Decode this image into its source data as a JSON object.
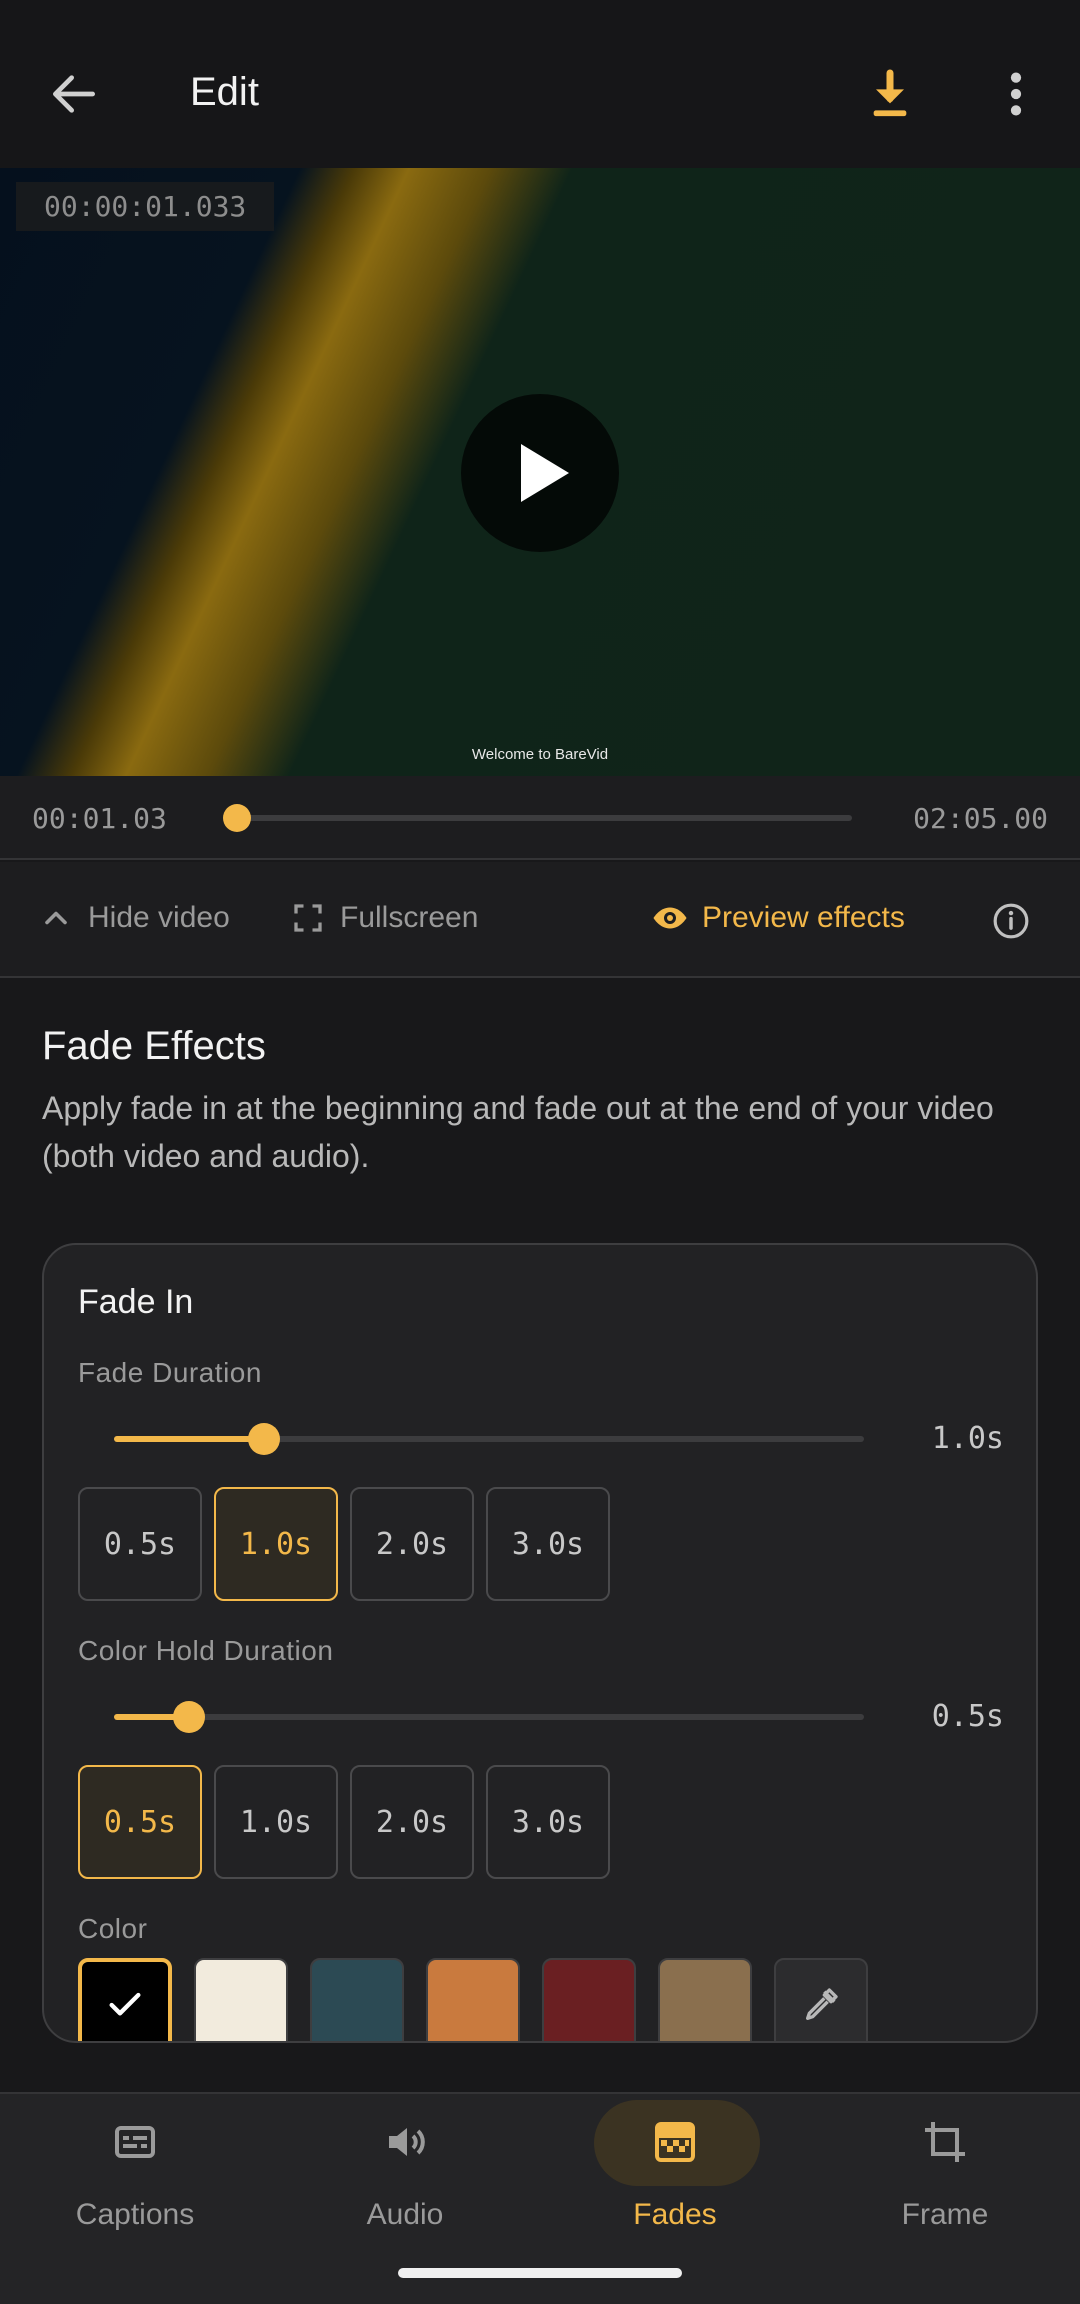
{
  "appbar": {
    "title": "Edit",
    "back_icon": "arrow-left-icon",
    "download_icon": "download-icon",
    "more_icon": "more-vertical-icon"
  },
  "video": {
    "overlay_timecode": "00:00:01.033",
    "watermark": "Welcome to BareVid",
    "play_icon": "play-icon"
  },
  "seek": {
    "current": "00:01.03",
    "total": "02:05.00",
    "progress": 0.0083
  },
  "controls": {
    "hide_video": "Hide video",
    "fullscreen": "Fullscreen",
    "preview_effects": "Preview effects"
  },
  "section": {
    "title": "Fade Effects",
    "description": "Apply fade in at the beginning and fade out at the end of your video (both video and audio)."
  },
  "fade_in": {
    "title": "Fade In",
    "fade_duration": {
      "label": "Fade Duration",
      "value_text": "1.0s",
      "fraction": 0.2,
      "options": [
        "0.5s",
        "1.0s",
        "2.0s",
        "3.0s"
      ],
      "selected": 1
    },
    "hold_duration": {
      "label": "Color Hold Duration",
      "value_text": "0.5s",
      "fraction": 0.1,
      "options": [
        "0.5s",
        "1.0s",
        "2.0s",
        "3.0s"
      ],
      "selected": 0
    },
    "color": {
      "label": "Color",
      "swatches": [
        "#000000",
        "#f2ebdd",
        "#2c4a54",
        "#c97a3e",
        "#6a1f22",
        "#8a6f4e"
      ],
      "selected": 0
    }
  },
  "nav": {
    "items": [
      {
        "label": "Captions",
        "icon": "captions-icon"
      },
      {
        "label": "Audio",
        "icon": "volume-icon"
      },
      {
        "label": "Fades",
        "icon": "fades-icon"
      },
      {
        "label": "Frame",
        "icon": "crop-icon"
      }
    ],
    "active": 2
  },
  "colors": {
    "accent": "#f3b84a",
    "background": "#18181a"
  }
}
